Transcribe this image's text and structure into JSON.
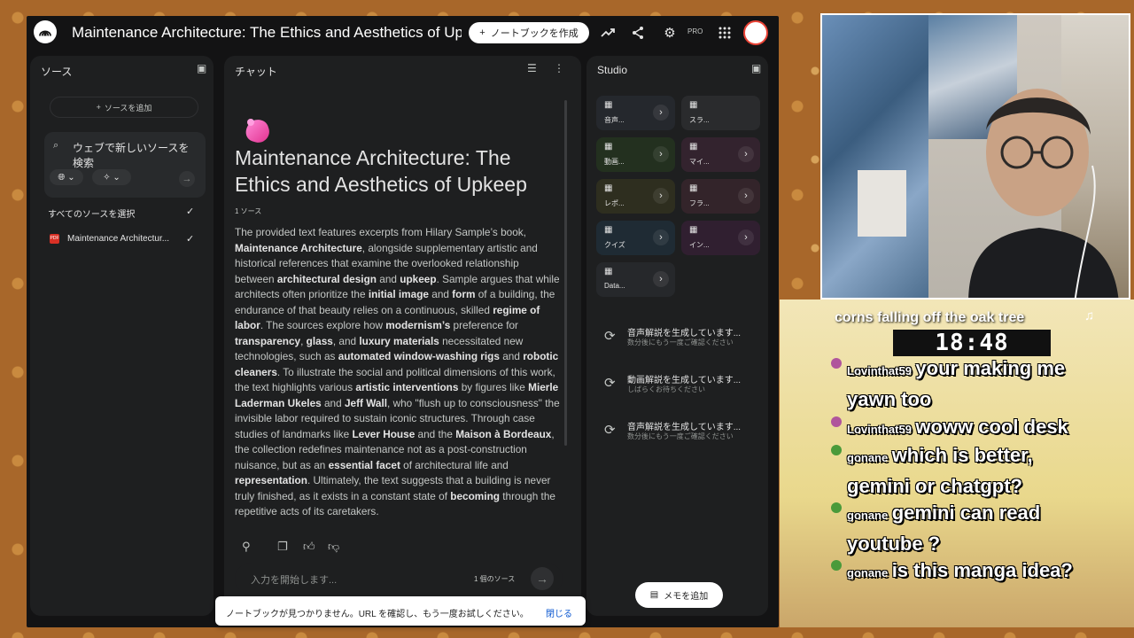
{
  "topbar": {
    "title": "Maintenance Architecture: The Ethics and Aesthetics of Upk",
    "create_label": "ノートブックを作成",
    "pro_badge": "PRO"
  },
  "sources": {
    "header": "ソース",
    "add_label": "ソースを追加",
    "search_text": "ウェブで新しいソースを検索",
    "select_all": "すべてのソースを選択",
    "items": [
      {
        "name": "Maintenance Architectur..."
      }
    ]
  },
  "chat": {
    "header": "チャット",
    "title": "Maintenance Architecture: The Ethics and Aesthetics of Upkeep",
    "source_count": "1 ソース",
    "input_placeholder": "入力を開始します...",
    "input_sources": "1 個のソース"
  },
  "studio": {
    "header": "Studio",
    "tiles": [
      {
        "label": "音声...",
        "icon": "audio-icon",
        "color": "#25282d"
      },
      {
        "label": "スラ...",
        "icon": "slides-icon",
        "color": "#2a2b2d"
      },
      {
        "label": "動画...",
        "icon": "video-icon",
        "color": "#23301f"
      },
      {
        "label": "マイ...",
        "icon": "mindmap-icon",
        "color": "#33232e"
      },
      {
        "label": "レポ...",
        "icon": "report-icon",
        "color": "#2e2e1f"
      },
      {
        "label": "フラ...",
        "icon": "flashcard-icon",
        "color": "#33242a"
      },
      {
        "label": "クイズ",
        "icon": "quiz-icon",
        "color": "#1f2b34"
      },
      {
        "label": "イン...",
        "icon": "infographic-icon",
        "color": "#301f30"
      },
      {
        "label": "Data...",
        "icon": "datatable-icon",
        "color": "#26282b"
      }
    ],
    "generating": [
      {
        "title": "音声解説を生成しています...",
        "sub": "数分後にもう一度ご確認ください"
      },
      {
        "title": "動画解説を生成しています...",
        "sub": "しばらくお待ちください"
      },
      {
        "title": "音声解説を生成しています...",
        "sub": "数分後にもう一度ご確認ください"
      }
    ],
    "memo_label": "メモを追加"
  },
  "toast": {
    "message": "ノートブックが見つかりません。URL を確認し、もう一度お試しください。",
    "close_label": "閉じる"
  },
  "stream": {
    "now_playing": "corns falling off the oak tree",
    "clock": "18:48",
    "chat": [
      {
        "user": "Lovinthat59",
        "text": "your making me yawn too",
        "badge": "pink"
      },
      {
        "user": "Lovinthat59",
        "text": "woww cool desk",
        "badge": "pink"
      },
      {
        "user": "gonane",
        "text": "which is better, gemini or chatgpt?",
        "badge": "green"
      },
      {
        "user": "gonane",
        "text": "gemini can read youtube ?",
        "badge": "green"
      },
      {
        "user": "gonane",
        "text": "is this manga idea?",
        "badge": "green"
      }
    ]
  },
  "colors": {
    "app_bg": "#131314",
    "panel_bg": "#1e1f20",
    "accent_link": "#0b57d0"
  }
}
